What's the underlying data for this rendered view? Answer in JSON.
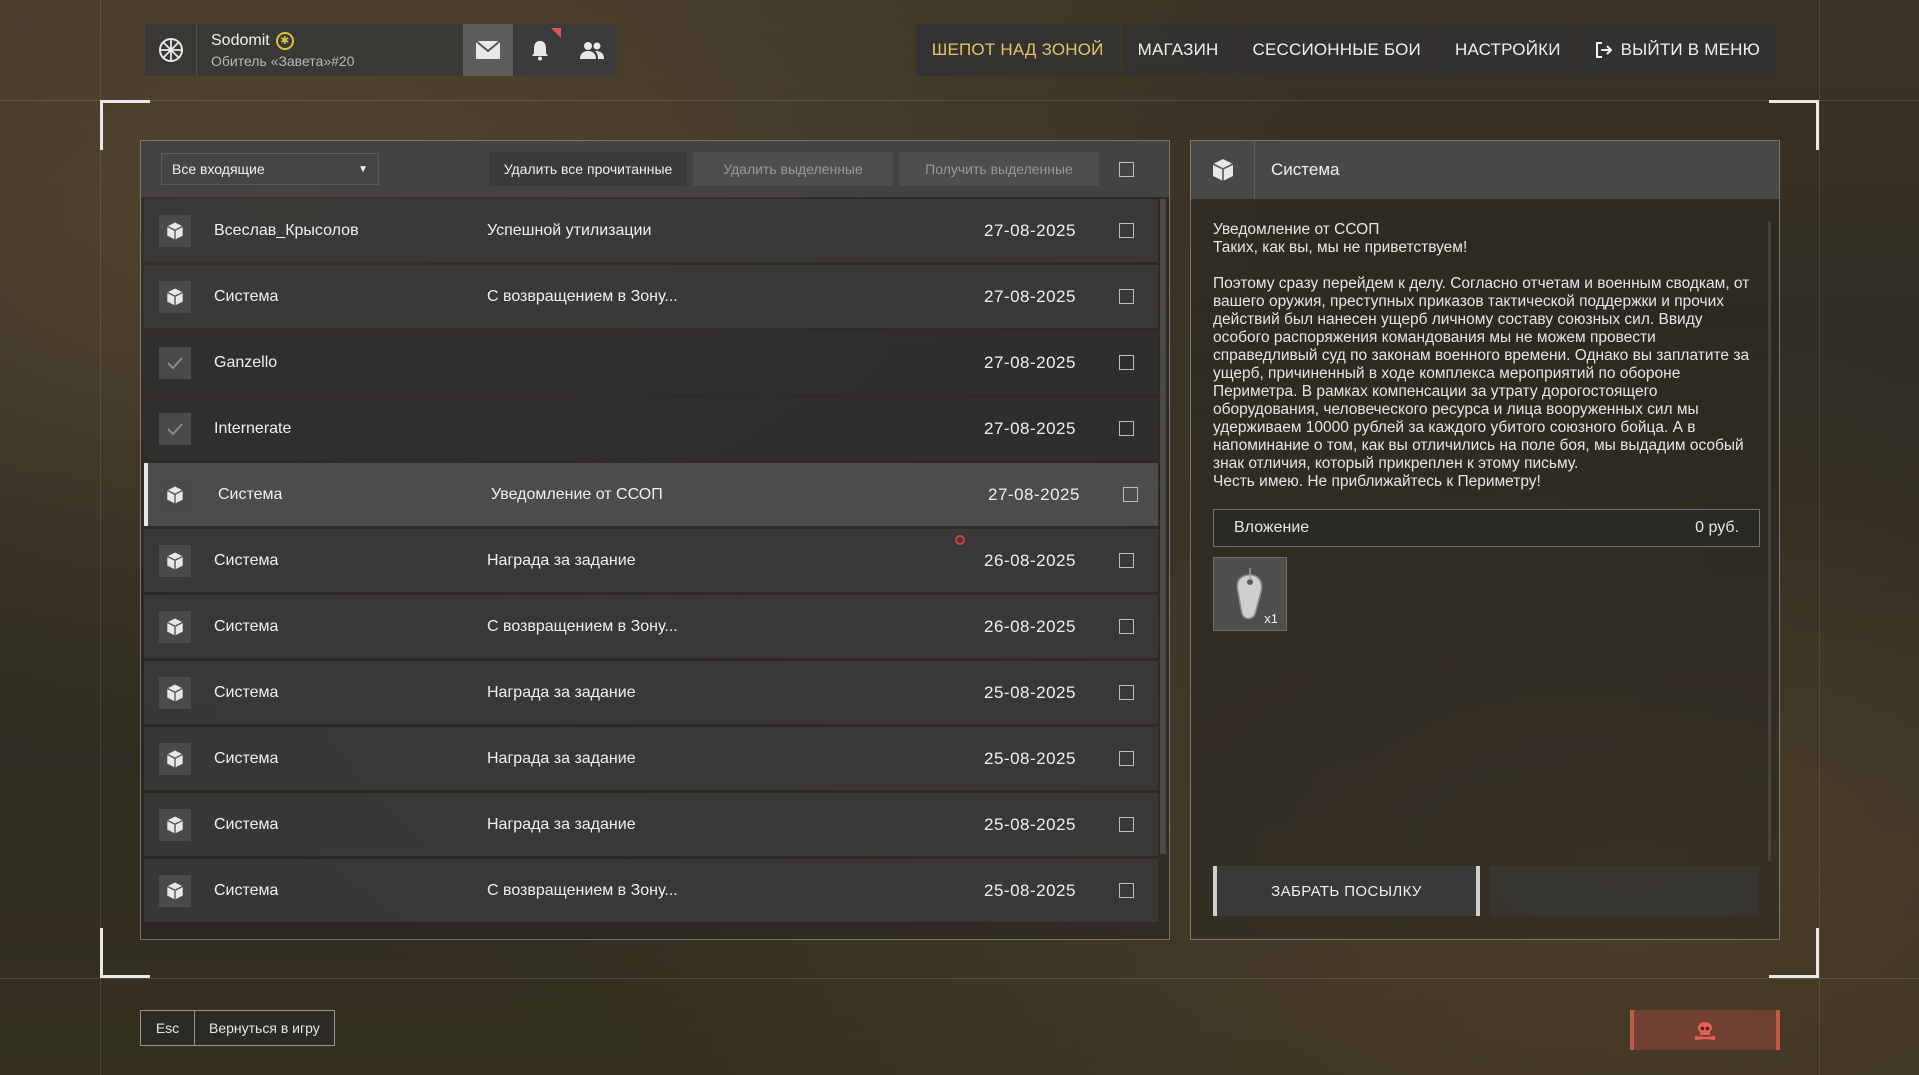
{
  "profile": {
    "name": "Sodomit",
    "faction": "Обитель «Завета»#20"
  },
  "nav": {
    "items": [
      {
        "label": "ШЕПОТ НАД ЗОНОЙ"
      },
      {
        "label": "МАГАЗИН"
      },
      {
        "label": "СЕССИОННЫЕ БОИ"
      },
      {
        "label": "НАСТРОЙКИ"
      },
      {
        "label": "ВЫЙТИ В МЕНЮ"
      }
    ]
  },
  "toolbar": {
    "filter_value": "Все входящие",
    "delete_read": "Удалить все прочитанные",
    "delete_selected": "Удалить выделенные",
    "receive_selected": "Получить выделенные"
  },
  "mails": [
    {
      "sender": "Всеслав_Крысолов",
      "subject": "Успешной утилизации",
      "date": "27-08-2025",
      "icon": "package-icon"
    },
    {
      "sender": "Система",
      "subject": "С возвращением в Зону...",
      "date": "27-08-2025",
      "icon": "package-icon"
    },
    {
      "sender": "Ganzello",
      "subject": "",
      "date": "27-08-2025",
      "icon": "check-icon"
    },
    {
      "sender": "Internerate",
      "subject": "",
      "date": "27-08-2025",
      "icon": "check-icon"
    },
    {
      "sender": "Система",
      "subject": "Уведомление от ССОП",
      "date": "27-08-2025",
      "icon": "package-icon"
    },
    {
      "sender": "Система",
      "subject": "Награда за задание",
      "date": "26-08-2025",
      "icon": "package-icon"
    },
    {
      "sender": "Система",
      "subject": "С возвращением в Зону...",
      "date": "26-08-2025",
      "icon": "package-icon"
    },
    {
      "sender": "Система",
      "subject": "Награда за задание",
      "date": "25-08-2025",
      "icon": "package-icon"
    },
    {
      "sender": "Система",
      "subject": "Награда за задание",
      "date": "25-08-2025",
      "icon": "package-icon"
    },
    {
      "sender": "Система",
      "subject": "Награда за задание",
      "date": "25-08-2025",
      "icon": "package-icon"
    },
    {
      "sender": "Система",
      "subject": "С возвращением в Зону...",
      "date": "25-08-2025",
      "icon": "package-icon"
    }
  ],
  "detail": {
    "sender": "Система",
    "heading": "Уведомление от ССОП",
    "greeting": "Таких, как вы, мы не приветствуем!",
    "body": "Поэтому сразу перейдем к делу. Согласно отчетам и военным сводкам, от вашего оружия, преступных приказов тактической поддержки и прочих действий был нанесен ущерб личному составу союзных сил. Ввиду особого распоряжения командования мы не можем провести справедливый суд по законам военного времени. Однако вы заплатите за ущерб, причиненный в ходе комплекса мероприятий по обороне Периметра. В рамках компенсации за утрату дорогостоящего оборудования, человеческого ресурса и лица вооруженных сил мы удерживаем 10000 рублей за каждого убитого союзного бойца. А в напоминание о том, как вы отличились на поле боя, мы выдадим особый знак отличия, который прикреплен к этому письму.",
    "closing": "Честь имею. Не приближайтесь к Периметру!",
    "attachment_label": "Вложение",
    "attachment_value": "0 руб.",
    "item_qty": "x1",
    "claim_label": "ЗАБРАТЬ ПОСЫЛКУ"
  },
  "footer": {
    "esc_key": "Esc",
    "esc_label": "Вернуться в игру"
  },
  "colors": {
    "accent_gold": "#e2c36a",
    "rank_yellow": "#d9c23a",
    "report_red": "#c05a4a"
  }
}
